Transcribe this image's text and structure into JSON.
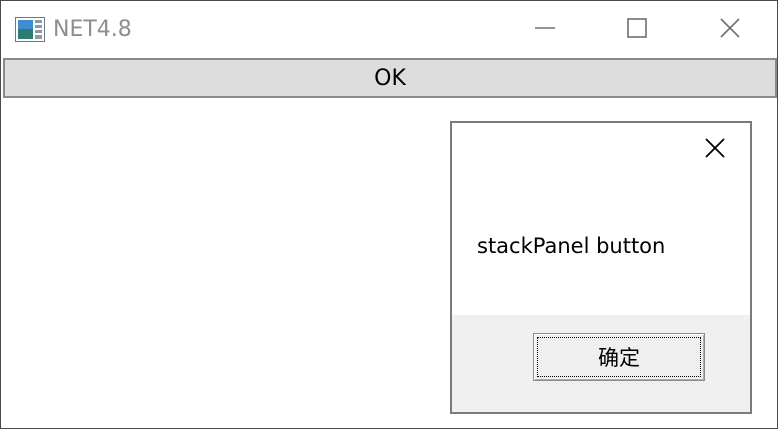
{
  "window": {
    "title": "NET4.8",
    "icon": "application-icon",
    "controls": [
      "minimize-icon",
      "maximize-icon",
      "close-icon"
    ]
  },
  "main": {
    "ok_label": "OK"
  },
  "dialog": {
    "message": "stackPanel button",
    "confirm_label": "确定",
    "close_icon": "close-icon"
  },
  "colors": {
    "title_text": "#8e8e8e",
    "ok_button_bg": "#dddddd",
    "dialog_footer_bg": "#f0f0f0"
  }
}
